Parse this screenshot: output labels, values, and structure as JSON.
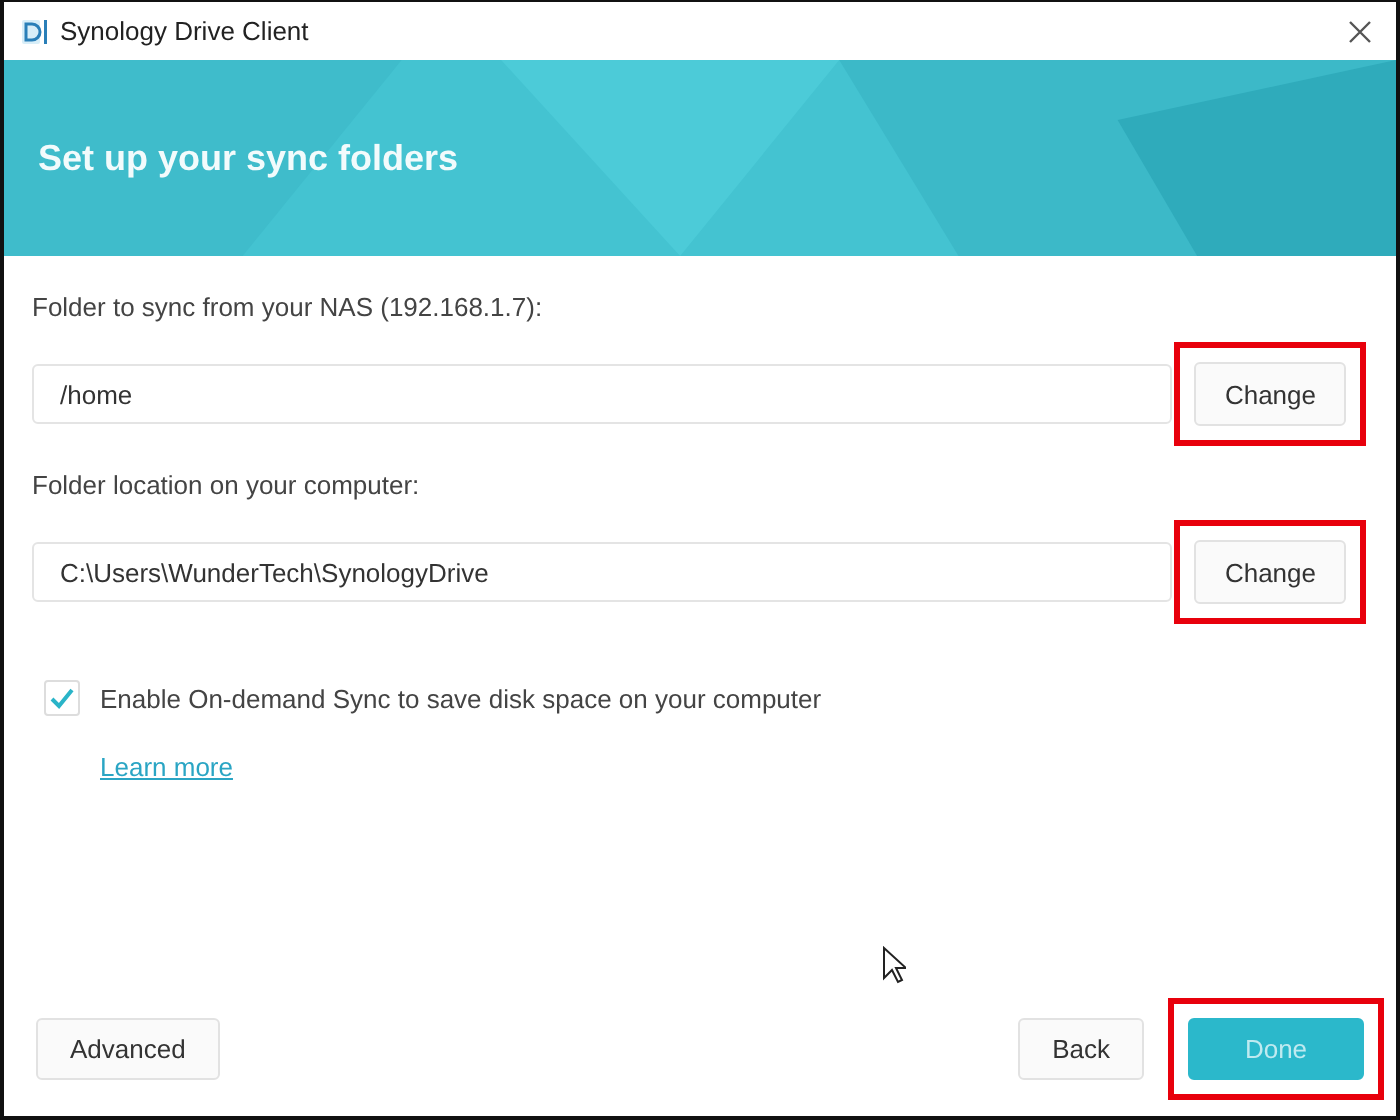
{
  "window": {
    "title": "Synology Drive Client"
  },
  "banner": {
    "title": "Set up your sync folders"
  },
  "fields": [
    {
      "label": "Folder to sync from your NAS (192.168.1.7):",
      "value": "/home",
      "button": {
        "label": "Change",
        "highlighted": true
      }
    },
    {
      "label": "Folder location on your computer:",
      "value": "C:\\Users\\WunderTech\\SynologyDrive",
      "button": {
        "label": "Change",
        "highlighted": true
      }
    }
  ],
  "on_demand": {
    "label": "Enable On-demand Sync to save disk space on your computer",
    "checked": true,
    "link": "Learn more"
  },
  "footer": {
    "left": [
      {
        "label": "Advanced",
        "kind": "plain",
        "highlighted": false
      }
    ],
    "right": [
      {
        "label": "Back",
        "kind": "plain",
        "highlighted": false
      },
      {
        "label": "Done",
        "kind": "primary",
        "highlighted": true
      }
    ]
  }
}
